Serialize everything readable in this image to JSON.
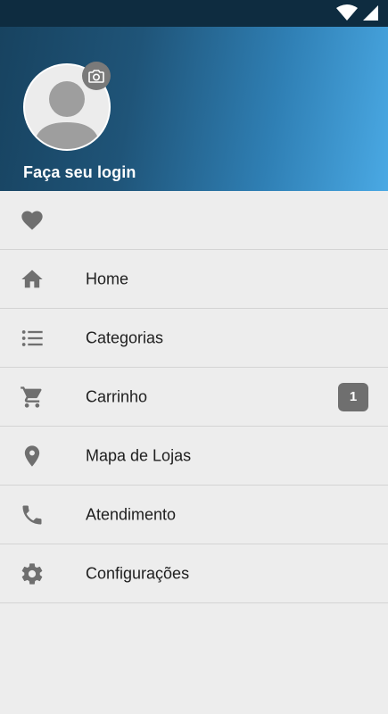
{
  "header": {
    "login_text": "Faça seu login",
    "gradient_colors": [
      "#17425f",
      "#4aa9e4"
    ]
  },
  "status_bar": {
    "icons": [
      "wifi-icon",
      "signal-icon"
    ]
  },
  "menu": {
    "favorites_icon": "heart-icon",
    "items": [
      {
        "label": "Home",
        "icon": "home-icon"
      },
      {
        "label": "Categorias",
        "icon": "list-icon"
      },
      {
        "label": "Carrinho",
        "icon": "cart-icon",
        "badge": "1"
      },
      {
        "label": "Mapa de Lojas",
        "icon": "location-pin-icon"
      },
      {
        "label": "Atendimento",
        "icon": "phone-icon"
      },
      {
        "label": "Configurações",
        "icon": "gear-icon"
      }
    ]
  },
  "colors": {
    "icon": "#6f6f6f",
    "badge_bg": "#6f6f6f",
    "menu_bg": "#ededed"
  }
}
